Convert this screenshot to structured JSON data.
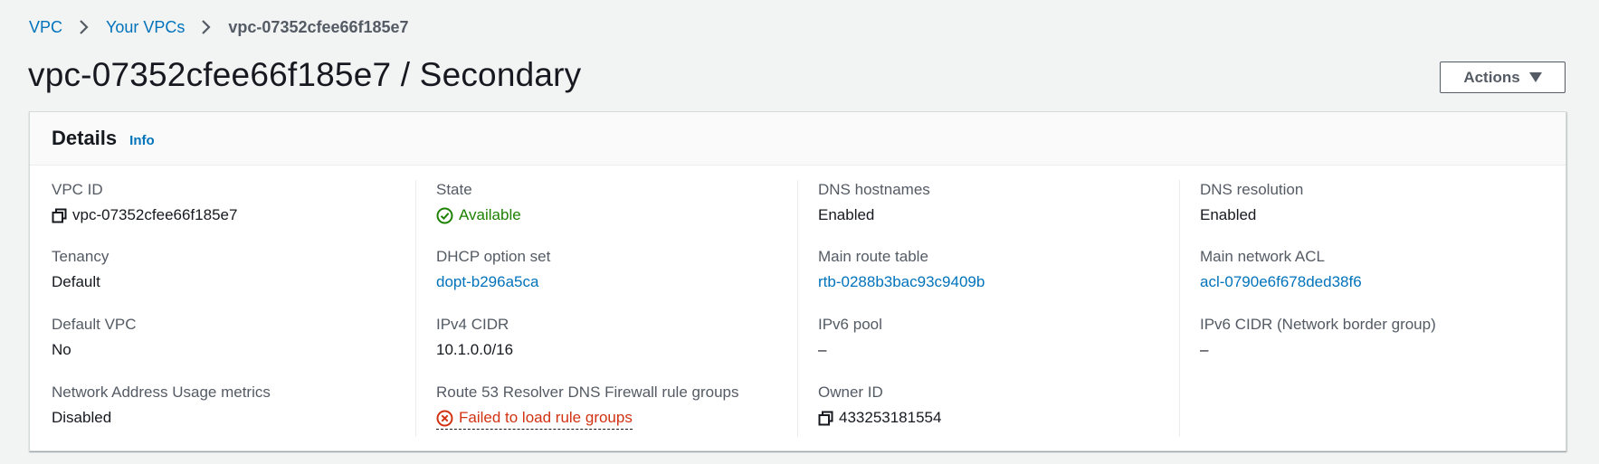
{
  "breadcrumb": {
    "items": [
      "VPC",
      "Your VPCs"
    ],
    "current": "vpc-07352cfee66f185e7"
  },
  "page": {
    "title": "vpc-07352cfee66f185e7 / Secondary",
    "actions_label": "Actions"
  },
  "details": {
    "title": "Details",
    "info_label": "Info",
    "fields": {
      "vpc_id": {
        "label": "VPC ID",
        "value": "vpc-07352cfee66f185e7"
      },
      "tenancy": {
        "label": "Tenancy",
        "value": "Default"
      },
      "default_vpc": {
        "label": "Default VPC",
        "value": "No"
      },
      "nau_metrics": {
        "label": "Network Address Usage metrics",
        "value": "Disabled"
      },
      "state": {
        "label": "State",
        "value": "Available"
      },
      "dhcp": {
        "label": "DHCP option set",
        "value": "dopt-b296a5ca"
      },
      "ipv4": {
        "label": "IPv4 CIDR",
        "value": "10.1.0.0/16"
      },
      "route53": {
        "label": "Route 53 Resolver DNS Firewall rule groups",
        "value": "Failed to load rule groups"
      },
      "dns_hostnames": {
        "label": "DNS hostnames",
        "value": "Enabled"
      },
      "main_route_table": {
        "label": "Main route table",
        "value": "rtb-0288b3bac93c9409b"
      },
      "ipv6_pool": {
        "label": "IPv6 pool",
        "value": "–"
      },
      "owner_id": {
        "label": "Owner ID",
        "value": "433253181554"
      },
      "dns_resolution": {
        "label": "DNS resolution",
        "value": "Enabled"
      },
      "main_acl": {
        "label": "Main network ACL",
        "value": "acl-0790e6f678ded38f6"
      },
      "ipv6_cidr": {
        "label": "IPv6 CIDR (Network border group)",
        "value": "–"
      }
    }
  },
  "colors": {
    "link": "#0073bb",
    "success": "#1d8102",
    "error": "#d13212",
    "label": "#545b64"
  }
}
